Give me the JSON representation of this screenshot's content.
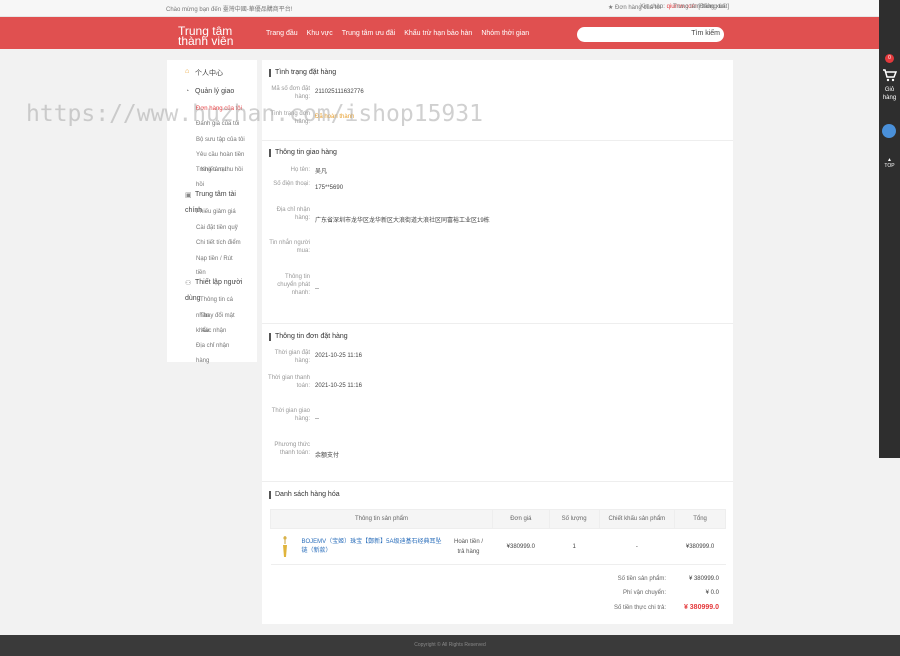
{
  "topbar": {
    "welcome": "Chào mừng bạn đến 臺灣中國-華優品購商平台!",
    "hello": "Xin chào:",
    "username": "qiumw.com",
    "logout": "[Đăng xuất]",
    "orders": "★ Đơn hàng của tôi",
    "info": "Trung tâm thông tin"
  },
  "header": {
    "logo": "Trung tâm thành viên",
    "nav": [
      "Trang đầu",
      "Khu vực",
      "Trung tâm ưu đãi",
      "Khấu trừ hạn bảo hàn",
      "Nhóm thời gian"
    ],
    "search_placeholder": "",
    "search_button": "Tìm kiếm"
  },
  "rightbar": {
    "badge": "0",
    "cart": "Giỏ hàng",
    "top": "TOP"
  },
  "sidebar": {
    "personal_center": "个人中心",
    "trade_mgmt": "Quản lý giao",
    "trade_items": [
      "Đơn hàng của tôi",
      "Đánh giá của tôi",
      "Bộ sưu tập của tôi",
      "Yêu cầu hoàn tiền",
      "Trung tâm thu hồi",
      "hồi"
    ],
    "trade_items_overlap": "Khiếu nại",
    "asset_center": "Trung tâm tài",
    "asset_center_2": "chính",
    "asset_items": [
      "Phiếu giảm giá",
      "Cài đặt tiền quỹ",
      "Chi tiết tích điểm",
      "Nạp tiền / Rút",
      "tiền"
    ],
    "settings": "Thiết lập người",
    "settings_2": "dùng",
    "settings_items": [
      "Thông tin cá",
      "nhân",
      "Thay đổi mật",
      "khẩu",
      "Xác nhận",
      "Địa chỉ nhận",
      "hàng"
    ]
  },
  "order_status": {
    "title": "Tình trạng đặt hàng",
    "order_no_label": "Mã số đơn đặt hàng:",
    "order_no": "211025111632776",
    "status_label": "Tình trạng đơn hàng:",
    "status": "Đã hoàn thành"
  },
  "delivery": {
    "title": "Thông tin giao hàng",
    "name_label": "Họ tên:",
    "name": "吴凡",
    "phone_label": "Số điện thoại:",
    "phone": "175**5690",
    "address_label": "Địa chỉ nhận hàng:",
    "address": "广东省深圳市龙华区龙华新区大浪街道大浪社区同富裕工业区19栋",
    "buyer_msg_label": "Tin nhắn người mua:",
    "buyer_msg": "",
    "shipping_label": "Thông tin chuyển phát nhanh:",
    "shipping": "--"
  },
  "order_info": {
    "title": "Thông tin đơn đặt hàng",
    "created_label": "Thời gian đặt hàng:",
    "created": "2021-10-25 11:16",
    "paid_label": "Thời gian thanh toán:",
    "paid": "2021-10-25 11:16",
    "delivered_label": "Thời gian giao hàng:",
    "delivered": "--",
    "method_label": "Phương thức thanh toán:",
    "method": "余额支付"
  },
  "products": {
    "title": "Danh sách hàng hóa",
    "headers": [
      "Thông tin sản phẩm",
      "Đơn giá",
      "Số lượng",
      "Chiết khấu sản phẩm",
      "Tổng"
    ],
    "rows": [
      {
        "name": "BOJEMV（宝姬）珠宝【鄭新】5A级迪基石经典耳坠链（新款）",
        "action": "Hoàn tiền / trả hàng",
        "price": "¥380999.0",
        "qty": "1",
        "discount": "-",
        "total": "¥380999.0"
      }
    ]
  },
  "summary": {
    "amount_label": "Số tiền sản phẩm:",
    "amount": "¥ 380999.0",
    "shipping_label": "Phí vận chuyển:",
    "shipping": "¥ 0.0",
    "paid_label": "Số tiền thực chi trả:",
    "paid": "¥ 380999.0"
  },
  "watermark": "https://www.huzhan.com/ishop15931",
  "footer": "Copyright © All Rights Reserved",
  "colors": {
    "accent": "#e05050",
    "link": "#2a6ebb",
    "price": "#e4393c"
  }
}
